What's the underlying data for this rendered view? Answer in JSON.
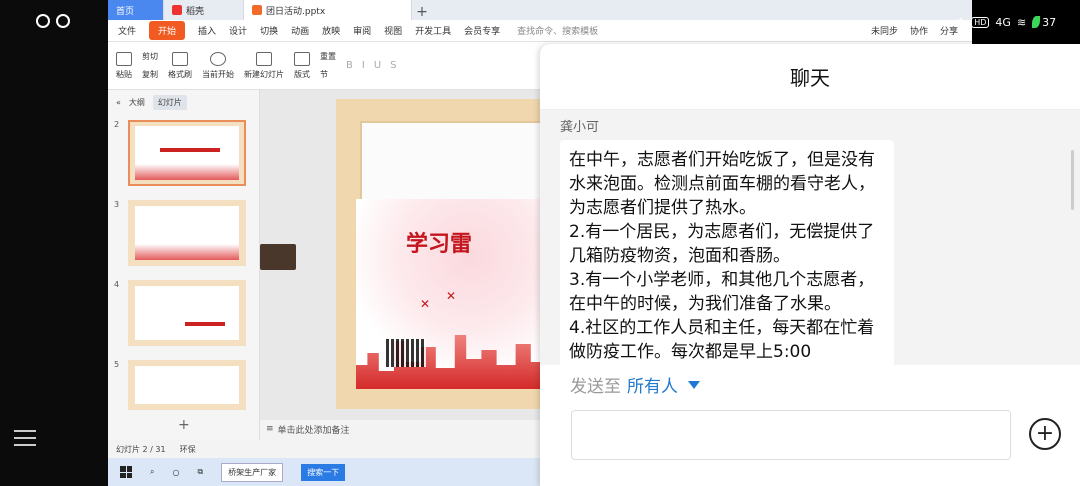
{
  "window": {
    "tabs": [
      {
        "label": "首页"
      },
      {
        "label": "稻壳"
      },
      {
        "label": "团日活动.pptx"
      }
    ],
    "new_tab": "+"
  },
  "menu": {
    "file": "文件",
    "items": [
      "开始",
      "插入",
      "设计",
      "切换",
      "动画",
      "放映",
      "审阅",
      "视图",
      "开发工具",
      "会员专享"
    ],
    "search_placeholder": "查找命令、搜索模板",
    "right": [
      "未同步",
      "协作",
      "分享"
    ]
  },
  "ribbon": {
    "paste": "粘贴",
    "cut": "剪切",
    "copy": "复制",
    "format_painter": "格式刷",
    "play_from_current": "当前开始",
    "new_slide": "新建幻灯片",
    "layout": "版式",
    "section": "节",
    "reset": "重置"
  },
  "slides_panel": {
    "outline": "大纲",
    "slides": "幻灯片",
    "numbers": [
      "2",
      "3",
      "4",
      "5"
    ],
    "add": "+"
  },
  "slide": {
    "title": "学习雷"
  },
  "notes_placeholder": "单击此处添加备注",
  "status": {
    "slide_count": "幻灯片 2 / 31",
    "theme": "环保"
  },
  "taskbar": {
    "ie_label": "桥架生产厂家",
    "search_btn": "搜索一下"
  },
  "phone": {
    "network": "4G",
    "hd": "HD",
    "battery": "37"
  },
  "chat": {
    "title": "聊天",
    "sender": "龚小可",
    "message": "在中午，志愿者们开始吃饭了，但是没有水来泡面。检测点前面车棚的看守老人，为志愿者们提供了热水。\n2.有一个居民，为志愿者们，无偿提供了几箱防疫物资，泡面和香肠。\n3.有一个小学老师，和其他几个志愿者，在中午的时候，为我们准备了水果。\n4.社区的工作人员和主任，每天都在忙着做防疫工作。每次都是早上5:00",
    "send_to_label": "发送至",
    "send_to_target": "所有人",
    "add_button": "+"
  }
}
